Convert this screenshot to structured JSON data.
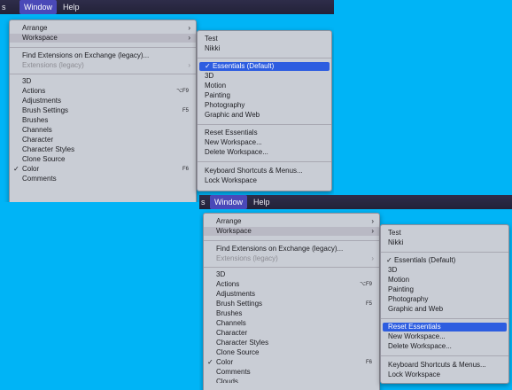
{
  "colors": {
    "background": "#00b4f6",
    "menubar": "#262540",
    "highlight": "#2d5de0"
  },
  "menubar": {
    "edge_label": "s",
    "window_label": "Window",
    "help_label": "Help"
  },
  "window_menu": {
    "arrange": "Arrange",
    "workspace": "Workspace",
    "find_extensions": "Find Extensions on Exchange (legacy)...",
    "extensions_legacy": "Extensions (legacy)",
    "item_3d": "3D",
    "actions": "Actions",
    "actions_shortcut": "⌥F9",
    "adjustments": "Adjustments",
    "brush_settings": "Brush Settings",
    "brush_settings_shortcut": "F5",
    "brushes": "Brushes",
    "channels": "Channels",
    "character": "Character",
    "character_styles": "Character Styles",
    "clone_source": "Clone Source",
    "color": "Color",
    "color_shortcut": "F6",
    "comments": "Comments",
    "clouds_cut": "Clouds",
    "checkmark": "✓",
    "submenu_arrow": "›"
  },
  "workspace_menu": {
    "test": "Test",
    "nikki": "Nikki",
    "essentials_default": "Essentials (Default)",
    "item_3d": "3D",
    "motion": "Motion",
    "painting": "Painting",
    "photography": "Photography",
    "graphic_and_web": "Graphic and Web",
    "reset_essentials": "Reset Essentials",
    "new_workspace": "New Workspace...",
    "delete_workspace": "Delete Workspace...",
    "keyboard_shortcuts": "Keyboard Shortcuts & Menus...",
    "lock_workspace": "Lock Workspace"
  }
}
